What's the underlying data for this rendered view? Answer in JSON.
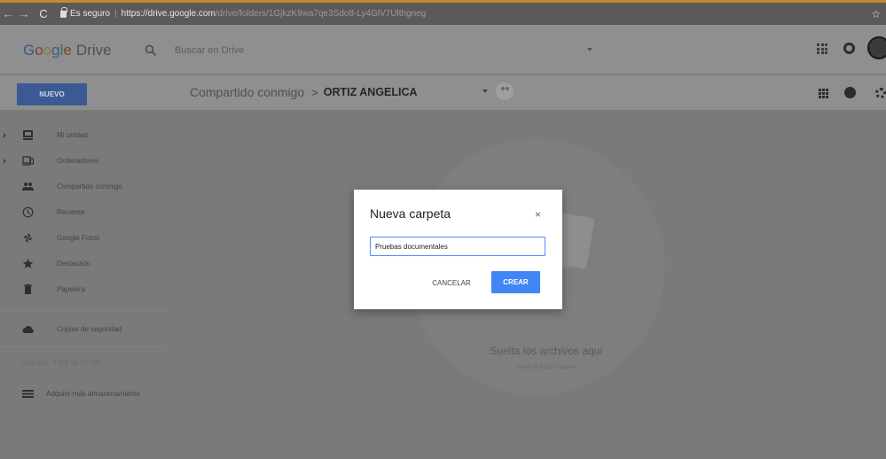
{
  "browser": {
    "secure_label": "Es seguro",
    "url_host": "https://drive.google.com",
    "url_path": "/drive/folders/1GjkzK9wa7qe3Sdo8-Ly4GlV7Ulthgneg"
  },
  "header": {
    "logo_letters": [
      "G",
      "o",
      "o",
      "g",
      "l",
      "e"
    ],
    "logo_product": "Drive",
    "search_placeholder": "Buscar en Drive"
  },
  "toolbar": {
    "new_label": "NUEVO",
    "breadcrumb_parent": "Compartido conmigo",
    "breadcrumb_separator": ">",
    "breadcrumb_current": "ORTIZ ANGELICA"
  },
  "sidebar": {
    "items": [
      {
        "label": "Mi unidad",
        "icon": "drive-icon"
      },
      {
        "label": "Ordenadores",
        "icon": "computers-icon"
      },
      {
        "label": "Compartido conmigo",
        "icon": "shared-people-icon"
      },
      {
        "label": "Reciente",
        "icon": "clock-icon"
      },
      {
        "label": "Google Fotos",
        "icon": "pinwheel-icon"
      },
      {
        "label": "Destacado",
        "icon": "star-icon"
      },
      {
        "label": "Papelera",
        "icon": "trash-icon"
      }
    ],
    "backup_label": "Copias de seguridad",
    "storage_text": "Utilizado: 2 GB de 15 GB",
    "buy_storage_label": "Adquirir más almacenamiento"
  },
  "main": {
    "drop_title": "Suelta los archivos aquí",
    "drop_subtitle": "o usa el botón Nuevo."
  },
  "dialog": {
    "title": "Nueva carpeta",
    "close_glyph": "×",
    "input_value": "Pruebas documentales",
    "cancel_label": "CANCELAR",
    "create_label": "CREAR"
  },
  "colors": {
    "new_button": "#3b5a93",
    "create_button": "#4285f4",
    "dialog_bg": "#ffffff",
    "overlay": "#7a7a7a"
  }
}
